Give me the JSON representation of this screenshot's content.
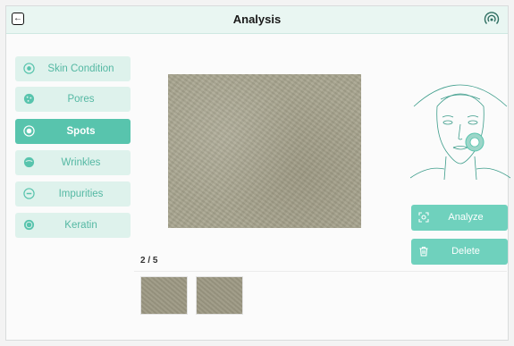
{
  "header": {
    "title": "Analysis",
    "back_icon": "back-arrow-icon",
    "right_icon": "signal-icon"
  },
  "sidebar": {
    "items": [
      {
        "label": "Skin Condition",
        "icon": "skin-condition-icon",
        "active": false
      },
      {
        "label": "Pores",
        "icon": "pores-icon",
        "active": false
      },
      {
        "label": "Spots",
        "icon": "spots-icon",
        "active": true
      },
      {
        "label": "Wrinkles",
        "icon": "wrinkles-icon",
        "active": false
      },
      {
        "label": "Impurities",
        "icon": "impurities-icon",
        "active": false
      },
      {
        "label": "Keratin",
        "icon": "keratin-icon",
        "active": false
      }
    ]
  },
  "actions": {
    "analyze_label": "Analyze",
    "analyze_icon": "scan-icon",
    "delete_label": "Delete",
    "delete_icon": "trash-icon"
  },
  "gallery": {
    "counter": "2 / 5"
  },
  "colors": {
    "accent": "#58c4ad",
    "accent_light": "#def2ec",
    "button": "#6fd1bd",
    "header_bg": "#e9f6f2"
  }
}
